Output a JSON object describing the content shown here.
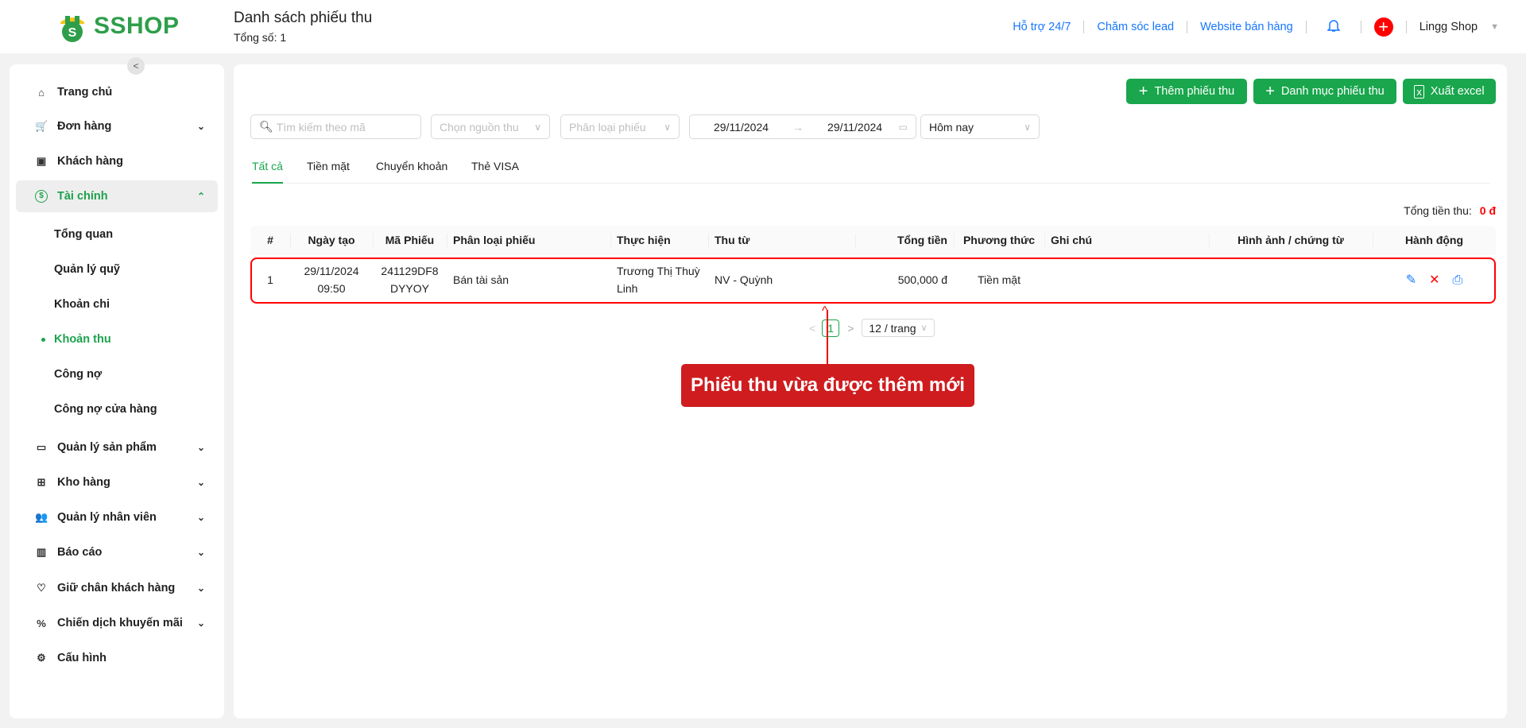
{
  "header": {
    "logo": "SSHOP",
    "title": "Danh sách phiếu thu",
    "subtitle": "Tổng số: 1",
    "links": [
      "Hỗ trợ 24/7",
      "Chăm sóc lead",
      "Website bán hàng"
    ],
    "user": "Lingg Shop"
  },
  "sidebar": {
    "items": [
      {
        "label": "Trang chủ",
        "icon": "⌂",
        "chev": ""
      },
      {
        "label": "Đơn hàng",
        "icon": "🛒",
        "chev": "⌄"
      },
      {
        "label": "Khách hàng",
        "icon": "▣",
        "chev": ""
      },
      {
        "label": "Tài chính",
        "icon": "$",
        "chev": "⌃"
      },
      {
        "label": "Quản lý sản phẩm",
        "icon": "▭",
        "chev": "⌄"
      },
      {
        "label": "Kho hàng",
        "icon": "⊞",
        "chev": "⌄"
      },
      {
        "label": "Quản lý nhân viên",
        "icon": "👥",
        "chev": "⌄"
      },
      {
        "label": "Báo cáo",
        "icon": "▥",
        "chev": "⌄"
      },
      {
        "label": "Giữ chân khách hàng",
        "icon": "♡",
        "chev": "⌄"
      },
      {
        "label": "Chiến dịch khuyến mãi",
        "icon": "%",
        "chev": "⌄"
      },
      {
        "label": "Cấu hình",
        "icon": "⚙",
        "chev": ""
      }
    ],
    "sub": [
      "Tổng quan",
      "Quản lý quỹ",
      "Khoản chi",
      "Khoản thu",
      "Công nợ",
      "Công nợ cửa hàng"
    ]
  },
  "toolbar": {
    "add": "Thêm phiếu thu",
    "category": "Danh mục phiếu thu",
    "export": "Xuất excel"
  },
  "filters": {
    "search_placeholder": "Tìm kiếm theo mã",
    "source_placeholder": "Chọn nguồn thu",
    "type_placeholder": "Phân loại phiếu",
    "date_from": "29/11/2024",
    "date_to": "29/11/2024",
    "range": "Hôm nay"
  },
  "tabs": [
    "Tất cả",
    "Tiền mặt",
    "Chuyển khoản",
    "Thẻ VISA"
  ],
  "total": {
    "label": "Tổng tiền thu:",
    "value": "0 đ"
  },
  "table": {
    "headers": [
      "#",
      "Ngày tạo",
      "Mã Phiếu",
      "Phân loại phiếu",
      "Thực hiện",
      "Thu từ",
      "Tổng tiền",
      "Phương thức",
      "Ghi chú",
      "Hình ảnh / chứng từ",
      "Hành động"
    ],
    "rows": [
      {
        "no": "1",
        "date": "29/11/2024",
        "time": "09:50",
        "code1": "241129DF8",
        "code2": "DYYOY",
        "type": "Bán tài sản",
        "by1": "Trương Thị Thuỳ",
        "by2": "Linh",
        "from": "NV - Quỳnh",
        "amount": "500,000 đ",
        "method": "Tiền mặt",
        "note": ""
      }
    ]
  },
  "pagination": {
    "page": "1",
    "size": "12 / trang"
  },
  "annotation": "Phiếu thu vừa được thêm mới",
  "colors": {
    "primary": "#19a64c",
    "highlight": "#f00",
    "link": "#1677ff"
  }
}
